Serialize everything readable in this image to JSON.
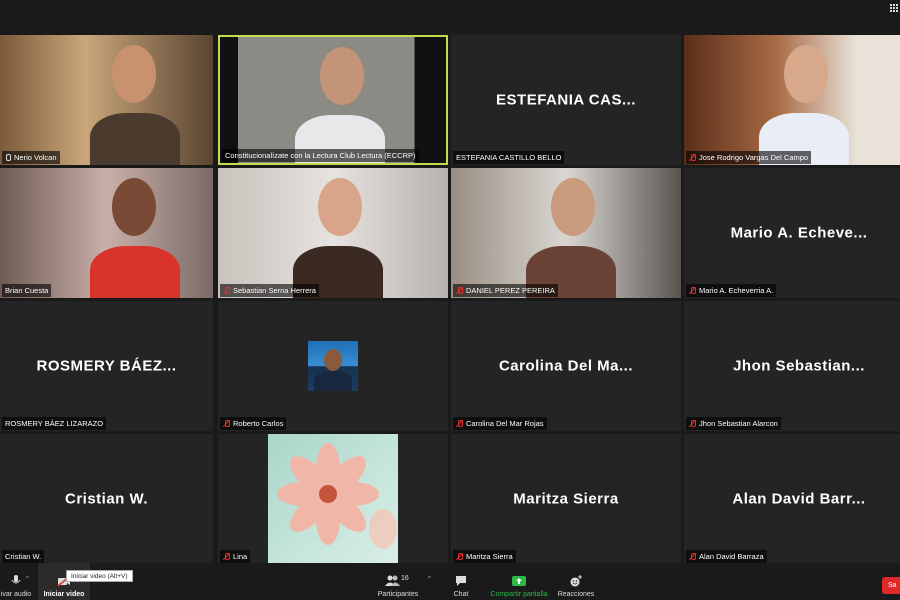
{
  "top_bar": {
    "view_icon": "gallery-grid-icon"
  },
  "participants": [
    {
      "display": "",
      "label": "Nerio Volcan",
      "mic": "on",
      "video": true
    },
    {
      "display": "",
      "label": "Constitucionalízate con la Lectura Club Lectura (ECCRP)",
      "mic": "none",
      "video": true,
      "active_speaker": true
    },
    {
      "display": "ESTEFANIA CAS...",
      "label": "ESTEFANIA CASTILLO BELLO",
      "mic": "none",
      "video": false
    },
    {
      "display": "",
      "label": "Jose Rodrigo Vargas Del Campo",
      "mic": "muted",
      "video": true
    },
    {
      "display": "",
      "label": "Brian Cuesta",
      "mic": "none",
      "video": true
    },
    {
      "display": "",
      "label": "Sebastian Serna Herrera",
      "mic": "muted",
      "video": true
    },
    {
      "display": "",
      "label": "DANIEL PEREZ PEREIRA",
      "mic": "muted",
      "video": true
    },
    {
      "display": "Mario A. Echeve...",
      "label": "Mario A. Echeverria A.",
      "mic": "muted",
      "video": false
    },
    {
      "display": "ROSMERY BÁEZ...",
      "label": "ROSMERY BÁEZ LIZARAZO",
      "mic": "none",
      "video": false
    },
    {
      "display": "",
      "label": "Roberto Carlos",
      "mic": "muted",
      "video": false,
      "thumb": true
    },
    {
      "display": "Carolina Del Ma...",
      "label": "Carolina Del Mar Rojas",
      "mic": "muted",
      "video": false
    },
    {
      "display": "Jhon Sebastian...",
      "label": "Jhon Sebastian Alarcon",
      "mic": "muted",
      "video": false
    },
    {
      "display": "Cristian W.",
      "label": "Cristian W.",
      "mic": "none",
      "video": false
    },
    {
      "display": "",
      "label": "Lina",
      "mic": "muted",
      "video": false,
      "flower": true
    },
    {
      "display": "Maritza Sierra",
      "label": "Maritza Sierra",
      "mic": "muted",
      "video": false
    },
    {
      "display": "Alan David Barr...",
      "label": "Alan David Barraza",
      "mic": "muted",
      "video": false
    }
  ],
  "toolbar": {
    "audio_label": "ivar audio",
    "video_label": "Iniciar video",
    "video_tooltip": "Iniciar video (Alt+V)",
    "participants_label": "Participantes",
    "participants_count": "16",
    "chat_label": "Chat",
    "share_label": "Compartir pantalla",
    "reactions_label": "Reacciones",
    "end_label": "Sa"
  },
  "colors": {
    "active_border": "#c8d94a",
    "muted_red": "#e03030",
    "share_green": "#2fb84a",
    "end_red": "#e02828"
  }
}
